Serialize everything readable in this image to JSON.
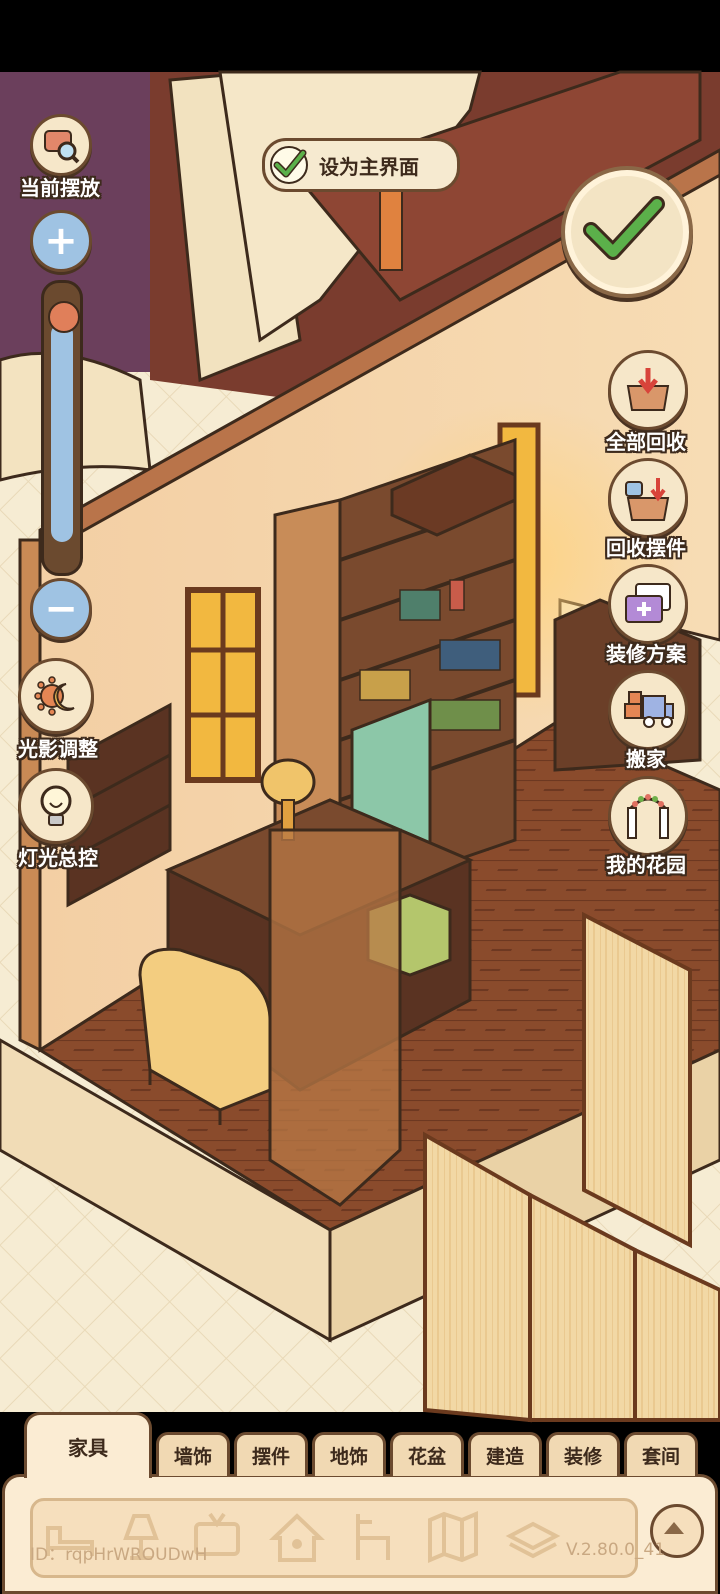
{
  "left_panel": {
    "current_placement_label": "当前摆放",
    "light_adjust_label": "光影调整",
    "light_control_label": "灯光总控",
    "zoom": {
      "plus": "+",
      "minus": "−",
      "level": 0.92
    }
  },
  "top": {
    "set_main_label": "设为主界面"
  },
  "right_panel": {
    "recycle_all_label": "全部回收",
    "recycle_items_label": "回收摆件",
    "renovation_plan_label": "装修方案",
    "move_house_label": "搬家",
    "my_garden_label": "我的花园"
  },
  "tabs": [
    {
      "label": "家具",
      "active": true
    },
    {
      "label": "墙饰",
      "active": false
    },
    {
      "label": "摆件",
      "active": false
    },
    {
      "label": "地饰",
      "active": false
    },
    {
      "label": "花盆",
      "active": false
    },
    {
      "label": "建造",
      "active": false
    },
    {
      "label": "装修",
      "active": false
    },
    {
      "label": "套间",
      "active": false
    }
  ],
  "categories": [
    {
      "icon": "bed-icon"
    },
    {
      "icon": "lamp-icon"
    },
    {
      "icon": "tv-icon"
    },
    {
      "icon": "pet-house-icon"
    },
    {
      "icon": "chair-icon"
    },
    {
      "icon": "map-icon"
    },
    {
      "icon": "stack-icon"
    }
  ],
  "footer": {
    "id_text": "ID：rqpHrWROUDwH",
    "version": "V.2.80.0_41"
  },
  "colors": {
    "outline": "#3d2a1c",
    "accent_green": "#5bb04a",
    "panel": "#fbecd3"
  }
}
